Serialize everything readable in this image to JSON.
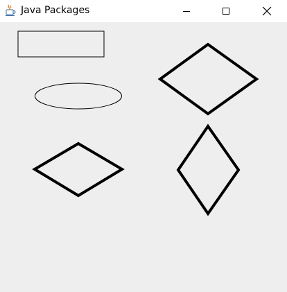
{
  "window": {
    "title": "Java Packages"
  },
  "titlebar_buttons": {
    "minimize_icon": "minimize-icon",
    "maximize_icon": "maximize-icon",
    "close_icon": "close-icon"
  },
  "canvas": {
    "background_color": "#eeeeee",
    "shapes": [
      {
        "kind": "rectangle",
        "stroke": "#000000",
        "stroke_weight": "thin"
      },
      {
        "kind": "ellipse",
        "stroke": "#000000",
        "stroke_weight": "thin"
      },
      {
        "kind": "diamond",
        "stroke": "#000000",
        "stroke_weight": "thick"
      },
      {
        "kind": "diamond",
        "stroke": "#000000",
        "stroke_weight": "thick"
      },
      {
        "kind": "diamond",
        "stroke": "#000000",
        "stroke_weight": "thick"
      }
    ]
  }
}
